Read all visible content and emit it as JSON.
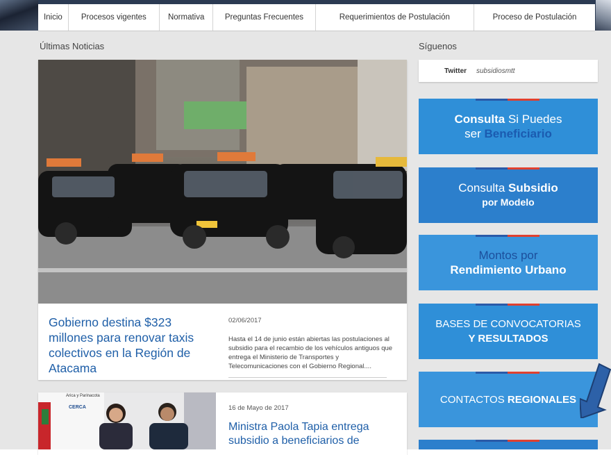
{
  "nav": {
    "items": [
      {
        "label": "Inicio"
      },
      {
        "label": "Procesos vigentes"
      },
      {
        "label": "Normativa"
      },
      {
        "label": "Preguntas Frecuentes"
      },
      {
        "label": "Requerimientos de Postulación"
      },
      {
        "label": "Proceso de Postulación"
      }
    ]
  },
  "news": {
    "section_title": "Últimas Noticias",
    "items": [
      {
        "headline": "Gobierno destina $323 millones para renovar taxis colectivos en la Región de Atacama",
        "date": "02/06/2017",
        "summary": "Hasta el 14 de junio están abiertas las postulaciones al subsidio para el recambio de los vehículos antiguos que entrega el Ministerio de Transportes y Telecomunicaciones con el Gobierno Regional...."
      },
      {
        "headline": "Ministra Paola Tapia entrega subsidio a beneficiarios de",
        "date": "16 de Mayo de 2017",
        "image_text": "Arica y Parinacota",
        "image_text2": "CERCA"
      }
    ]
  },
  "sidebar": {
    "section_title": "Síguenos",
    "twitter_label": "Twitter",
    "twitter_handle": "subsidiosmtt",
    "promos": [
      {
        "l1a": "Consulta",
        "l1b": " Si Puedes",
        "l2a": "ser ",
        "l2b": "Beneficiario",
        "color": "#2f8fd8"
      },
      {
        "l1a": "Consulta ",
        "l1b": "Subsidio",
        "l2": "por Modelo",
        "color": "#2c7fcc"
      },
      {
        "l1": "Montos por",
        "l2": "Rendimiento Urbano",
        "color": "#3a95dc"
      },
      {
        "l1": "BASES DE CONVOCATORIAS",
        "l2": "Y RESULTADOS",
        "color": "#2f8fd8"
      },
      {
        "l1a": "CONTACTOS ",
        "l1b": "REGIONALES",
        "color": "#3a95dc"
      }
    ]
  },
  "colors": {
    "accent_blue": "#1f5fa8",
    "bar_blue": "#2a5aa8",
    "bar_red": "#e0402f",
    "arrow": "#2d61a8"
  }
}
